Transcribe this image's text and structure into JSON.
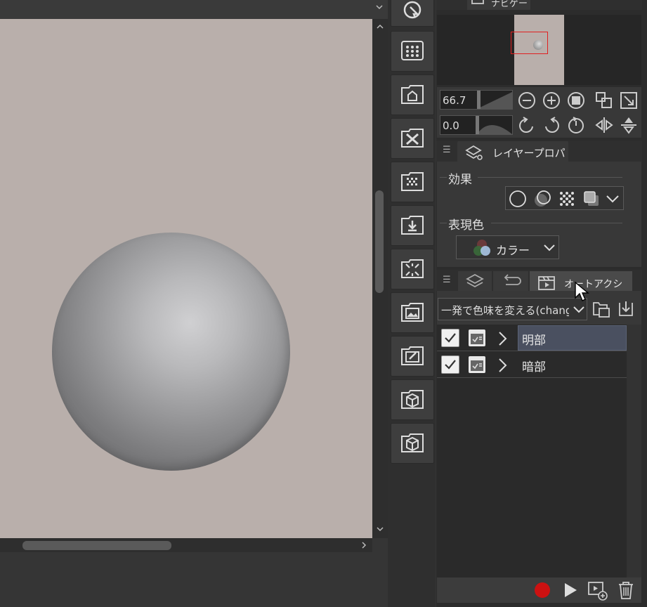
{
  "navigator": {
    "tab_label": "ナビゲー",
    "zoom_value": "66.7",
    "rotate_value": "0.0"
  },
  "layer_property": {
    "tab_label": "レイヤープロパティ",
    "effect_label": "効果",
    "color_label": "表現色",
    "color_mode": "カラー"
  },
  "auto_action": {
    "tab_label": "オートアクション",
    "set_name": "一発で色味を変える(change",
    "items": [
      {
        "label": "明部",
        "checked": true,
        "selected": true
      },
      {
        "label": "暗部",
        "checked": true,
        "selected": false
      }
    ]
  },
  "colors": {
    "canvas_paper": "#b9afab",
    "record_red": "#cc1111",
    "selected_row": "#4a5060"
  },
  "material_icons": [
    "pointer-icon",
    "dot-grid-icon",
    "house-icon",
    "x-icon",
    "checker-icon",
    "download-icon",
    "burst-icon",
    "image-icon",
    "edit-icon",
    "cube-icon",
    "cube-icon"
  ]
}
